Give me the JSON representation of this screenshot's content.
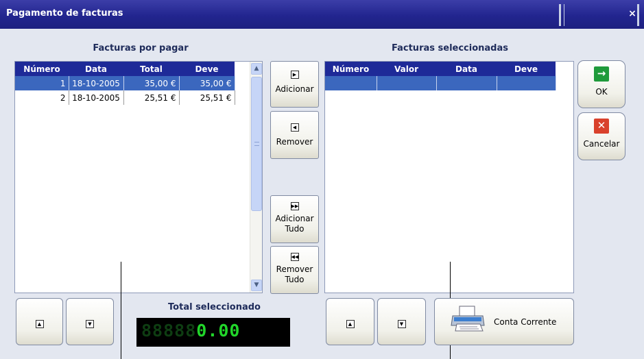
{
  "window": {
    "title": "Pagamento de facturas",
    "close_glyph": "×"
  },
  "left_panel": {
    "title": "Facturas por pagar",
    "columns": [
      "Número",
      "Data",
      "Total",
      "Deve"
    ],
    "rows": [
      {
        "numero": "1",
        "data": "18-10-2005",
        "total": "35,00 €",
        "deve": "35,00 €",
        "selected": true
      },
      {
        "numero": "2",
        "data": "18-10-2005",
        "total": "25,51 €",
        "deve": "25,51 €",
        "selected": false
      }
    ]
  },
  "right_panel": {
    "title": "Facturas seleccionadas",
    "columns": [
      "Número",
      "Valor",
      "Data",
      "Deve"
    ]
  },
  "middle_buttons": {
    "adicionar": "Adicionar",
    "remover": "Remover",
    "adicionar_tudo_1": "Adicionar",
    "adicionar_tudo_2": "Tudo",
    "remover_tudo_1": "Remover",
    "remover_tudo_2": "Tudo"
  },
  "side_buttons": {
    "ok": "OK",
    "cancelar": "Cancelar"
  },
  "total": {
    "label": "Total seleccionado",
    "inactive_digits": "88888",
    "value": "0.00"
  },
  "conta_corrente": "Conta Corrente",
  "colors": {
    "title_bar": "#22258f",
    "grid_header": "#1e2a98",
    "selection": "#3b67be",
    "lcd_on": "#21d62a",
    "ok_icon": "#1f9a3b",
    "cancel_icon": "#d9412c"
  },
  "icons": {
    "up": "up-arrow-icon",
    "down": "down-arrow-icon",
    "ok": "check-arrow-icon",
    "cancel": "x-icon",
    "printer": "printer-icon"
  }
}
